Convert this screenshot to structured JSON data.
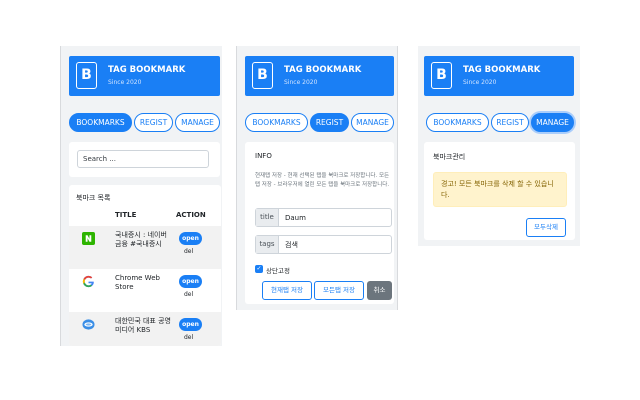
{
  "app": {
    "title": "TAG BOOKMARK",
    "subtitle": "Since 2020",
    "logo_letter": "B"
  },
  "tabs": {
    "bookmarks": "BOOKMARKS",
    "regist": "REGIST",
    "manage": "MANAGE"
  },
  "bookmarks_view": {
    "search_placeholder": "Search ...",
    "list_title": "북마크 목록",
    "columns": {
      "title": "TITLE",
      "action": "ACTION"
    },
    "rows": [
      {
        "title": "국내증시 : 네이버 금융 #국내증시",
        "icon": "naver-favicon",
        "open_label": "open",
        "del_label": "del"
      },
      {
        "title": "Chrome Web Store",
        "icon": "google-favicon",
        "open_label": "open",
        "del_label": "del"
      },
      {
        "title": "대한민국 대표 공영미디어 KBS",
        "icon": "kbs-favicon",
        "open_label": "open",
        "del_label": "del"
      }
    ]
  },
  "regist_view": {
    "section_title": "INFO",
    "info_text": "현재탭 저장 - 현재 선택된 탭을 북마크로 저장합니다. 모든탭 저장 - 브라우저에 열린 모든 탭을 북마크로 저장합니다.",
    "title_label": "title",
    "title_value": "Daum",
    "tags_label": "tags",
    "tags_value": "검색",
    "pin_label": "상단고정",
    "save_current": "현재탭 저장",
    "save_all": "모든탭 저장",
    "cancel": "취소"
  },
  "manage_view": {
    "section_title": "북마크관리",
    "warning": "경고! 모든 북마크를 삭제 할 수 있습니다.",
    "delete_all": "모두삭제"
  },
  "colors": {
    "primary": "#1a7ff5",
    "background": "#f1f3f5",
    "warning_bg": "#fff3cd",
    "warning_text": "#856404",
    "secondary": "#6c757d"
  }
}
